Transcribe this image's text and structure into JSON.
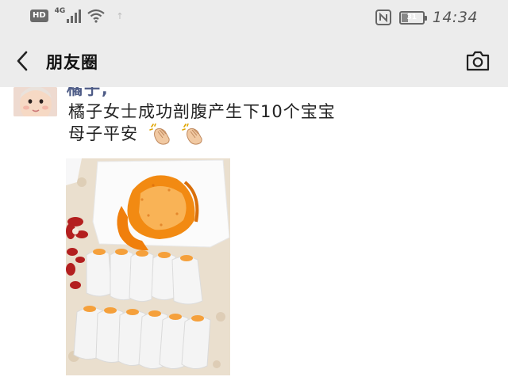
{
  "status_bar": {
    "hd_label": "HD",
    "network_type": "4G",
    "time": "14:34",
    "battery_level": "31",
    "battery_fraction": 0.31
  },
  "nav": {
    "title": "朋友圈",
    "back_icon": "chevron-left-icon",
    "camera_icon": "camera-icon"
  },
  "post": {
    "author": "橘子,",
    "text_line1": "橘子女士成功剖腹产生下10个宝宝",
    "text_line2": "母子平安"
  },
  "colors": {
    "bar_bg": "#ececec",
    "author_name": "#4d5b86",
    "orange": "#f28a12"
  }
}
